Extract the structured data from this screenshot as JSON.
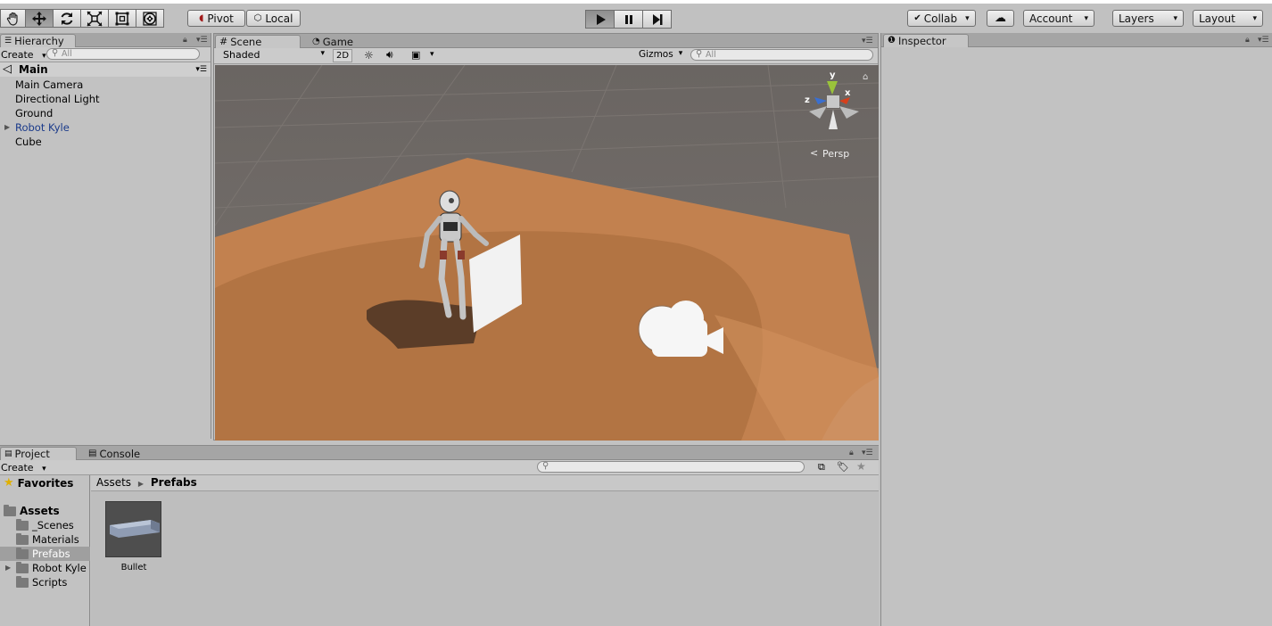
{
  "toolbar": {
    "tools": [
      {
        "name": "hand-tool",
        "icon": "hand-icon",
        "active": false
      },
      {
        "name": "move-tool",
        "icon": "move-icon",
        "active": true
      },
      {
        "name": "rotate-tool",
        "icon": "rotate-icon",
        "active": false
      },
      {
        "name": "scale-tool",
        "icon": "scale-icon",
        "active": false
      },
      {
        "name": "rect-tool",
        "icon": "rect-icon",
        "active": false
      },
      {
        "name": "transform-tool",
        "icon": "transform-icon",
        "active": false
      }
    ],
    "pivot_label": "Pivot",
    "local_label": "Local",
    "collab_label": "Collab",
    "account_label": "Account",
    "layers_label": "Layers",
    "layout_label": "Layout"
  },
  "hierarchy": {
    "tab_label": "Hierarchy",
    "create_label": "Create",
    "search_placeholder": "All",
    "scene_name": "Main",
    "items": [
      {
        "label": "Main Camera",
        "color": "#000000",
        "expandable": false
      },
      {
        "label": "Directional Light",
        "color": "#000000",
        "expandable": false
      },
      {
        "label": "Ground",
        "color": "#000000",
        "expandable": false
      },
      {
        "label": "Robot Kyle",
        "color": "#1a3a8a",
        "expandable": true
      },
      {
        "label": "Cube",
        "color": "#000000",
        "expandable": false
      }
    ]
  },
  "scene": {
    "tabs": [
      {
        "label": "Scene",
        "active": true
      },
      {
        "label": "Game",
        "active": false
      }
    ],
    "shading_mode": "Shaded",
    "mode_2d_label": "2D",
    "gizmos_label": "Gizmos",
    "search_placeholder": "All",
    "gizmo_axes": {
      "x": "x",
      "y": "y",
      "z": "z"
    },
    "projection_label": "Persp",
    "colors": {
      "sky": "#6e6a67",
      "ground": "#b7774a",
      "ground_light": "#c98a58"
    }
  },
  "inspector": {
    "tab_label": "Inspector"
  },
  "project": {
    "tabs": [
      {
        "label": "Project",
        "active": true
      },
      {
        "label": "Console",
        "active": false
      }
    ],
    "create_label": "Create",
    "favorites_label": "Favorites",
    "assets_label": "Assets",
    "folders": [
      {
        "label": "_Scenes",
        "selected": false,
        "expandable": false
      },
      {
        "label": "Materials",
        "selected": false,
        "expandable": false
      },
      {
        "label": "Prefabs",
        "selected": true,
        "expandable": false
      },
      {
        "label": "Robot Kyle",
        "selected": false,
        "expandable": true
      },
      {
        "label": "Scripts",
        "selected": false,
        "expandable": false
      }
    ],
    "breadcrumb": {
      "root": "Assets",
      "current": "Prefabs"
    },
    "assets": [
      {
        "label": "Bullet",
        "type": "prefab"
      }
    ]
  }
}
